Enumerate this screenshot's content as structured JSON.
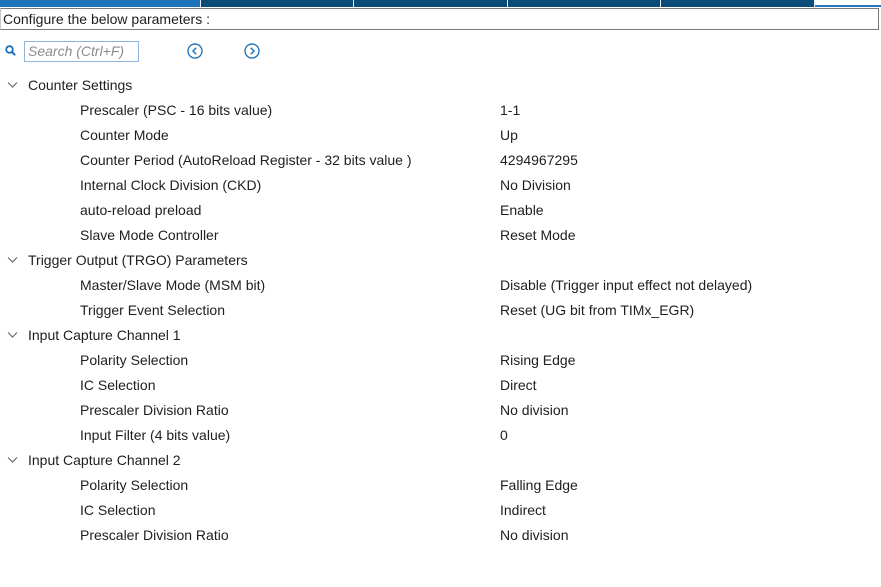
{
  "header": {
    "instruction": "Configure the below parameters :"
  },
  "toolbar": {
    "search_placeholder": "Search (Ctrl+F)",
    "icons": [
      "search-icon",
      "previous-icon",
      "next-icon"
    ]
  },
  "colors": {
    "accent": "#1b74b8",
    "tab_dark": "#0a4b78",
    "icon_blue": "#2a78b8"
  },
  "groups": [
    {
      "label": "Counter Settings",
      "params": [
        {
          "name": "Prescaler (PSC - 16 bits value)",
          "value": "1-1"
        },
        {
          "name": "Counter Mode",
          "value": "Up"
        },
        {
          "name": "Counter Period (AutoReload Register - 32 bits value )",
          "value": "4294967295"
        },
        {
          "name": "Internal Clock Division (CKD)",
          "value": "No Division"
        },
        {
          "name": "auto-reload preload",
          "value": "Enable"
        },
        {
          "name": "Slave Mode Controller",
          "value": "Reset Mode"
        }
      ]
    },
    {
      "label": "Trigger Output (TRGO) Parameters",
      "params": [
        {
          "name": "Master/Slave Mode (MSM bit)",
          "value": "Disable (Trigger input effect not delayed)"
        },
        {
          "name": "Trigger Event Selection",
          "value": "Reset (UG bit from TIMx_EGR)"
        }
      ]
    },
    {
      "label": "Input Capture Channel 1",
      "params": [
        {
          "name": "Polarity Selection",
          "value": "Rising Edge"
        },
        {
          "name": "IC Selection",
          "value": "Direct"
        },
        {
          "name": "Prescaler Division Ratio",
          "value": "No division"
        },
        {
          "name": "Input Filter (4 bits value)",
          "value": "0"
        }
      ]
    },
    {
      "label": "Input Capture Channel 2",
      "params": [
        {
          "name": "Polarity Selection",
          "value": "Falling Edge"
        },
        {
          "name": "IC Selection",
          "value": "Indirect"
        },
        {
          "name": "Prescaler Division Ratio",
          "value": "No division"
        }
      ]
    }
  ]
}
